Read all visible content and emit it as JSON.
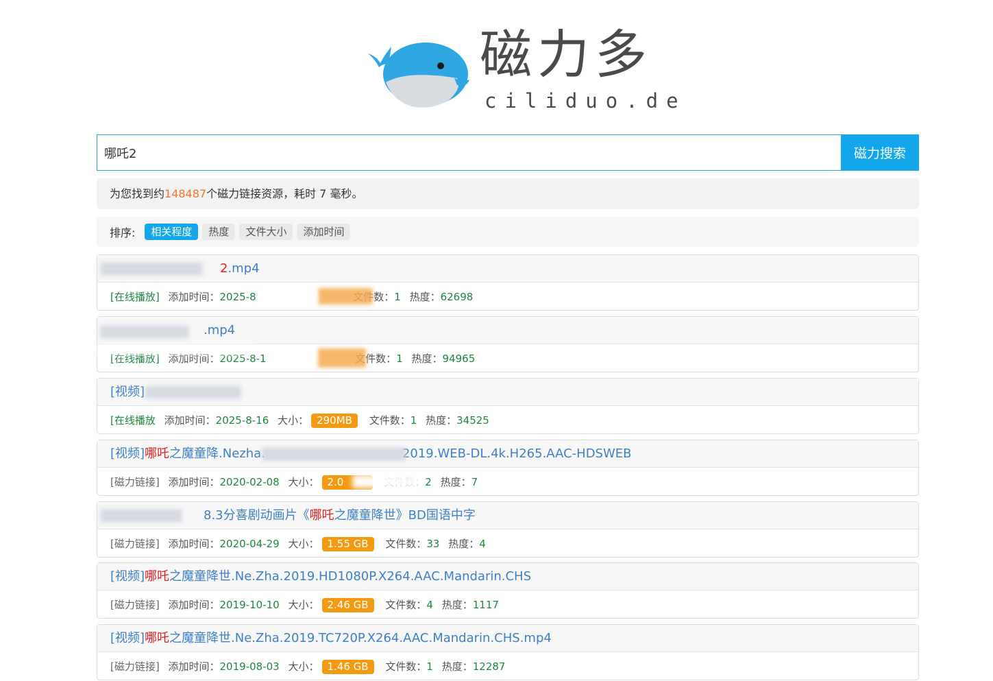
{
  "brand": {
    "name_cn": "磁力多",
    "domain": "ciliduo.de",
    "logo": "whale-logo"
  },
  "search": {
    "value": "哪吒2",
    "button_label": "磁力搜索"
  },
  "stats": {
    "prefix": "为您找到约",
    "count": "148487",
    "suffix": "个磁力链接资源，耗时 7 毫秒。"
  },
  "sort": {
    "label": "排序:",
    "options": [
      {
        "label": "相关程度",
        "active": true
      },
      {
        "label": "热度",
        "active": false
      },
      {
        "label": "文件大小",
        "active": false
      },
      {
        "label": "添加时间",
        "active": false
      }
    ]
  },
  "labels": {
    "added": "添加时间：",
    "size": "大小：",
    "files": "文件数：",
    "heat": "热度："
  },
  "results": [
    {
      "title_pre": "",
      "title_hl": "2",
      "title_post": ".mp4",
      "action": "[在线播放]",
      "date": "2025-8",
      "size": "",
      "files": "1",
      "heat": "62698"
    },
    {
      "title_pre": "",
      "title_hl": "",
      "title_post": ".mp4",
      "action": "[在线播放]",
      "date": "2025-8-1",
      "size": "",
      "files": "1",
      "heat": "94965"
    },
    {
      "title_pre": "[视频] ",
      "title_hl": "",
      "title_post": "",
      "action": "[在线播放",
      "date": "2025-8-16",
      "size": "290MB",
      "files": "1",
      "heat": "34525"
    },
    {
      "title_pre": "[视频]",
      "title_hl": "哪吒",
      "title_post": "之魔童降.Nezha.",
      "title_tail": "2019.WEB-DL.4k.H265.AAC-HDSWEB",
      "action": "[磁力链接]",
      "date": "2020-02-08",
      "size": "2.0",
      "files": "2",
      "heat": "7"
    },
    {
      "title_pre": "8.3分喜剧动画片《",
      "title_hl": "哪吒",
      "title_post": "之魔童降世》BD国语中字",
      "action": "[磁力链接]",
      "date": "2020-04-29",
      "size": "1.55 GB",
      "files": "33",
      "heat": "4"
    },
    {
      "title_pre": "[视频]",
      "title_hl": "哪吒",
      "title_post": "之魔童降世.Ne.Zha.2019.HD1080P.X264.AAC.Mandarin.CHS",
      "action": "[磁力链接]",
      "date": "2019-10-10",
      "size": "2.46 GB",
      "files": "4",
      "heat": "1117"
    },
    {
      "title_pre": "[视频]",
      "title_hl": "哪吒",
      "title_post": "之魔童降世.Ne.Zha.2019.TC720P.X264.AAC.Mandarin.CHS.mp4",
      "action": "[磁力链接]",
      "date": "2019-08-03",
      "size": "1.46 GB",
      "files": "1",
      "heat": "12287"
    }
  ]
}
